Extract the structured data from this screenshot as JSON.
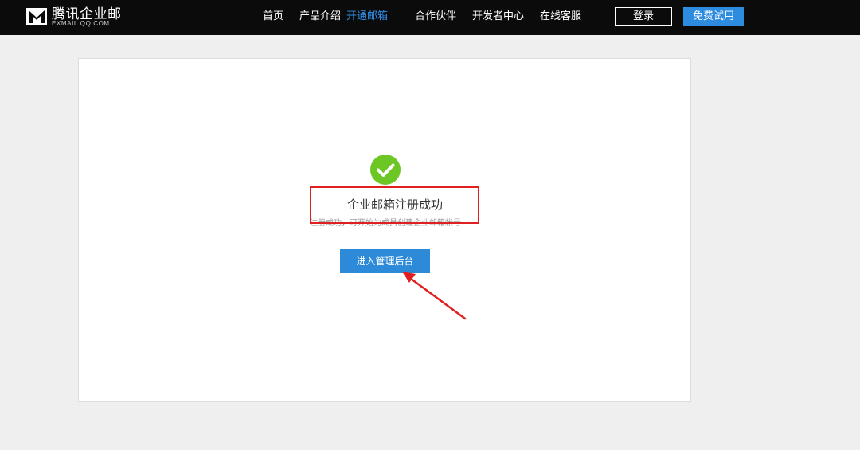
{
  "header": {
    "logo_title": "腾讯企业邮",
    "logo_subtitle": "EXMAIL.QQ.COM",
    "nav": [
      {
        "label": "首页"
      },
      {
        "label": "产品介绍"
      },
      {
        "label": "开通邮箱",
        "active": true
      },
      {
        "label": "合作伙伴"
      },
      {
        "label": "开发者中心"
      },
      {
        "label": "在线客服"
      }
    ],
    "login_label": "登录",
    "trial_label": "免费试用"
  },
  "main": {
    "success_icon": "check-circle-icon",
    "title": "企业邮箱注册成功",
    "subtitle": "注册成功，可开始为成员创建企业邮箱帐号",
    "admin_button_label": "进入管理后台"
  },
  "colors": {
    "topbar": "#0b0b0b",
    "nav_active": "#2f8ee8",
    "primary_button": "#2d8ad8",
    "success_green": "#6cc624",
    "annotation_red": "#e02020"
  }
}
